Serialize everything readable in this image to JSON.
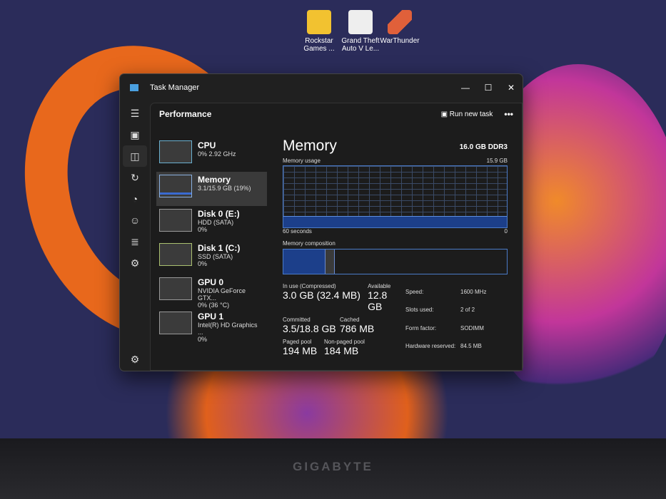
{
  "desktop": {
    "icons": [
      {
        "label": "Rockstar Games ..."
      },
      {
        "label": "Grand Theft Auto V Le..."
      },
      {
        "label": "WarThunder"
      }
    ],
    "brand": "GIGABYTE"
  },
  "window": {
    "title": "Task Manager",
    "minimize": "—",
    "maximize": "☐",
    "close": "✕"
  },
  "header": {
    "title": "Performance",
    "run_new_task": "Run new task",
    "more": "•••"
  },
  "rail": [
    "☰",
    "▣",
    "◫",
    "↻",
    "◔",
    "☺",
    "≣",
    "⚙"
  ],
  "settings_icon": "⚙",
  "devices": [
    {
      "name": "CPU",
      "line1": "0% 2.92 GHz",
      "line2": ""
    },
    {
      "name": "Memory",
      "line1": "3.1/15.9 GB (19%)",
      "line2": ""
    },
    {
      "name": "Disk 0 (E:)",
      "line1": "HDD (SATA)",
      "line2": "0%"
    },
    {
      "name": "Disk 1 (C:)",
      "line1": "SSD (SATA)",
      "line2": "0%"
    },
    {
      "name": "GPU 0",
      "line1": "NVIDIA GeForce GTX...",
      "line2": "0% (36 °C)"
    },
    {
      "name": "GPU 1",
      "line1": "Intel(R) HD Graphics ...",
      "line2": "0%"
    }
  ],
  "memory": {
    "title": "Memory",
    "spec": "16.0 GB DDR3",
    "usage_label": "Memory usage",
    "usage_max": "15.9 GB",
    "time_label": "60 seconds",
    "zero": "0",
    "usage_fraction": 0.19,
    "composition_label": "Memory composition",
    "in_use_label": "In use (Compressed)",
    "in_use": "3.0 GB (32.4 MB)",
    "available_label": "Available",
    "available": "12.8 GB",
    "committed_label": "Committed",
    "committed": "3.5/18.8 GB",
    "cached_label": "Cached",
    "cached": "786 MB",
    "paged_label": "Paged pool",
    "paged": "194 MB",
    "nonpaged_label": "Non-paged pool",
    "nonpaged": "184 MB",
    "props": [
      {
        "k": "Speed:",
        "v": "1600 MHz"
      },
      {
        "k": "Slots used:",
        "v": "2 of 2"
      },
      {
        "k": "Form factor:",
        "v": "SODIMM"
      },
      {
        "k": "Hardware reserved:",
        "v": "84.5 MB"
      }
    ]
  }
}
